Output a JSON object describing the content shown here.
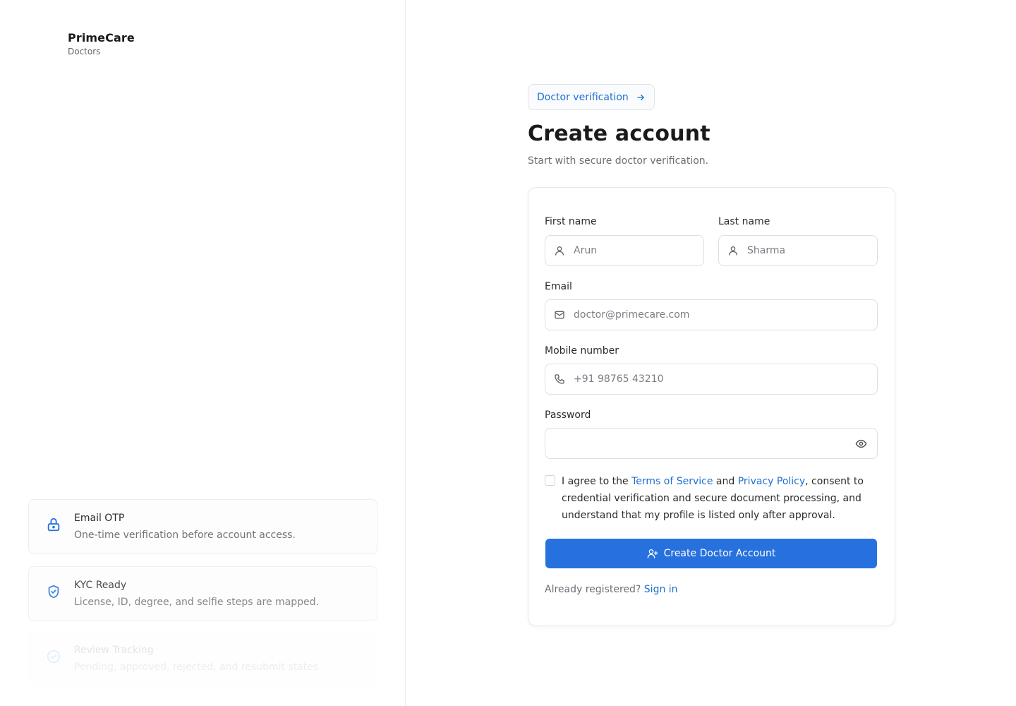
{
  "brand": {
    "name": "PrimeCare",
    "subtitle": "Doctors"
  },
  "features": [
    {
      "title": "Email OTP",
      "description": "One-time verification before account access.",
      "icon": "lock-icon"
    },
    {
      "title": "KYC Ready",
      "description": "License, ID, degree, and selfie steps are mapped.",
      "icon": "shield-check-icon"
    },
    {
      "title": "Review Tracking",
      "description": "Pending, approved, rejected, and resubmit states.",
      "icon": "check-circle-icon"
    }
  ],
  "chip": {
    "label": "Doctor verification",
    "icon": "arrow-right-icon"
  },
  "heading": {
    "title": "Create account",
    "subtitle": "Start with secure doctor verification."
  },
  "form": {
    "first_name": {
      "label": "First name",
      "placeholder": "Arun",
      "value": "",
      "icon": "user-icon"
    },
    "last_name": {
      "label": "Last name",
      "placeholder": "Sharma",
      "value": "",
      "icon": "user-icon"
    },
    "email": {
      "label": "Email",
      "placeholder": "doctor@primecare.com",
      "value": "",
      "icon": "mail-icon"
    },
    "mobile": {
      "label": "Mobile number",
      "placeholder": "+91 98765 43210",
      "value": "",
      "icon": "phone-icon"
    },
    "password": {
      "label": "Password",
      "placeholder": "",
      "value": "",
      "icon": "eye-icon"
    },
    "consent": {
      "checked": false,
      "prefix": "I agree to the ",
      "terms_link": "Terms of Service",
      "middle": " and ",
      "privacy_link": "Privacy Policy",
      "suffix": ", consent to credential verification and secure document processing, and understand that my profile is listed only after approval."
    },
    "submit_label": "Create Doctor Account",
    "submit_icon": "user-plus-icon",
    "signin_prompt": "Already registered?",
    "signin_link": "Sign in"
  },
  "colors": {
    "accent": "#2771de",
    "link": "#1f6fd1",
    "muted_text": "#6b6f75",
    "border": "#dcdfe3"
  }
}
